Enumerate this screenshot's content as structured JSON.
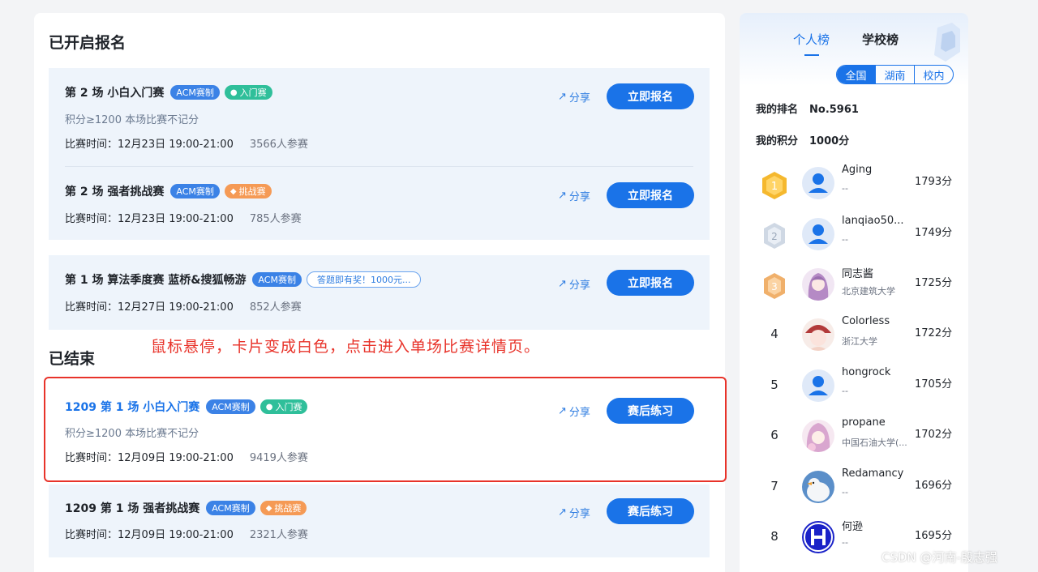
{
  "open": {
    "heading": "已开启报名",
    "contests": [
      {
        "title": "第 2 场 小白入门赛",
        "tags": [
          {
            "kind": "acm",
            "label": "ACM赛制"
          },
          {
            "kind": "entry",
            "label": "入门赛"
          }
        ],
        "sub": "积分≥1200 本场比赛不记分",
        "time": "比赛时间：12月23日 19:00-21:00",
        "count": "3566人参赛",
        "share": "分享",
        "button": "立即报名"
      },
      {
        "title": "第 2 场 强者挑战赛",
        "tags": [
          {
            "kind": "acm",
            "label": "ACM赛制"
          },
          {
            "kind": "chal",
            "label": "挑战赛"
          }
        ],
        "time": "比赛时间：12月23日 19:00-21:00",
        "count": "785人参赛",
        "share": "分享",
        "button": "立即报名"
      },
      {
        "title": "第 1 场 算法季度赛 蓝桥&搜狐畅游",
        "tags": [
          {
            "kind": "acm",
            "label": "ACM赛制"
          },
          {
            "kind": "prize",
            "label": "答题即有奖！1000元..."
          }
        ],
        "time": "比赛时间：12月27日 19:00-21:00",
        "count": "852人参赛",
        "share": "分享",
        "button": "立即报名"
      }
    ]
  },
  "ended": {
    "heading": "已结束",
    "contests": [
      {
        "title": "1209 第 1 场 小白入门赛",
        "tags": [
          {
            "kind": "acm",
            "label": "ACM赛制"
          },
          {
            "kind": "entry",
            "label": "入门赛"
          }
        ],
        "sub": "积分≥1200 本场比赛不记分",
        "time": "比赛时间：12月09日 19:00-21:00",
        "count": "9419人参赛",
        "share": "分享",
        "button": "赛后练习"
      },
      {
        "title": "1209 第 1 场 强者挑战赛",
        "tags": [
          {
            "kind": "acm",
            "label": "ACM赛制"
          },
          {
            "kind": "chal",
            "label": "挑战赛"
          }
        ],
        "time": "比赛时间：12月09日 19:00-21:00",
        "count": "2321人参赛",
        "share": "分享",
        "button": "赛后练习"
      }
    ]
  },
  "annotation": "鼠标悬停，卡片变成白色，点击进入单场比赛详情页。",
  "sidebar": {
    "tabs": [
      "个人榜",
      "学校榜"
    ],
    "scopes": [
      "全国",
      "湖南",
      "校内"
    ],
    "my_rank_label": "我的排名",
    "my_rank_value": "No.5961",
    "my_score_label": "我的积分",
    "my_score_value": "1000分",
    "ranking": [
      {
        "rank": "1",
        "name": "Aging",
        "school": "--",
        "score": "1793分",
        "avatar": "default"
      },
      {
        "rank": "2",
        "name": "lanqiao50...",
        "school": "--",
        "score": "1749分",
        "avatar": "default"
      },
      {
        "rank": "3",
        "name": "同志酱",
        "school": "北京建筑大学",
        "score": "1725分",
        "avatar": "anime-purple"
      },
      {
        "rank": "4",
        "name": "Colorless",
        "school": "浙江大学",
        "score": "1722分",
        "avatar": "anime-red"
      },
      {
        "rank": "5",
        "name": "hongrock",
        "school": "--",
        "score": "1705分",
        "avatar": "default"
      },
      {
        "rank": "6",
        "name": "propane",
        "school": "中国石油大学(...",
        "score": "1702分",
        "avatar": "anime-pink"
      },
      {
        "rank": "7",
        "name": "Redamancy",
        "school": "--",
        "score": "1696分",
        "avatar": "goose"
      },
      {
        "rank": "8",
        "name": "何逊",
        "school": "--",
        "score": "1695分",
        "avatar": "letter-h"
      }
    ]
  },
  "watermark": "CSDN @河南-殷志强",
  "colors": {
    "primary": "#1a73e8",
    "card_bg": "#eef4fb",
    "annotation_red": "#e8332a",
    "gold": "#f5b82e",
    "silver": "#b8c4d4",
    "bronze": "#e8a25a"
  }
}
